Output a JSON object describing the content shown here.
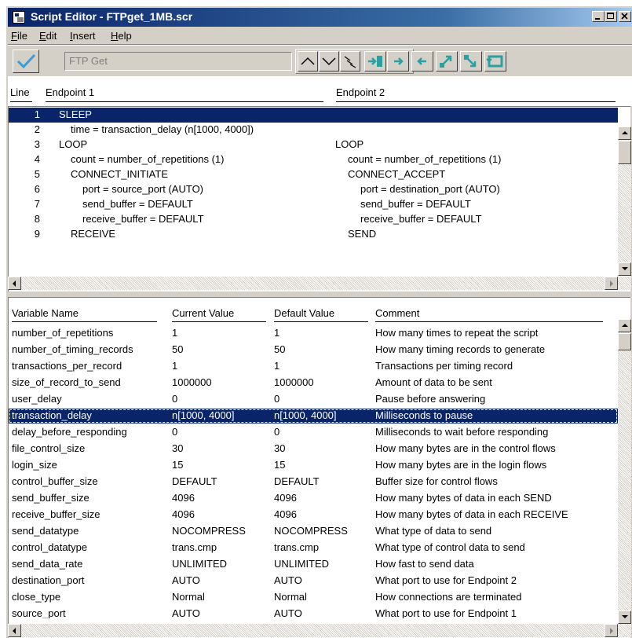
{
  "window": {
    "title": "Script Editor - FTPget_1MB.scr",
    "caption_buttons": [
      "minimize",
      "maximize",
      "close"
    ]
  },
  "menu": [
    {
      "label": "File",
      "accel": "F",
      "rest": "ile"
    },
    {
      "label": "Edit",
      "accel": "E",
      "rest": "dit"
    },
    {
      "label": "Insert",
      "accel": "I",
      "rest": "nsert"
    },
    {
      "label": "Help",
      "accel": "H",
      "rest": "elp"
    }
  ],
  "toolbar": {
    "script_name_placeholder": "FTP Get",
    "icons": [
      "checkmark-icon",
      "move-up-icon",
      "move-down-icon",
      "expand-icon",
      "insert-after-icon",
      "move-right-icon",
      "move-left-icon",
      "swap-icon",
      "copy-icon",
      "loop-icon"
    ]
  },
  "script": {
    "headers": {
      "line": "Line",
      "endpoint1": "Endpoint 1",
      "endpoint2": "Endpoint 2"
    },
    "rows": [
      {
        "num": "1",
        "ep1": "SLEEP",
        "ep2": "",
        "selected": true
      },
      {
        "num": "2",
        "ep1": "time = transaction_delay (n[1000, 4000])",
        "ep2": ""
      },
      {
        "num": "3",
        "ep1": "LOOP",
        "ep2": "LOOP"
      },
      {
        "num": "4",
        "ep1": "count = number_of_repetitions (1)",
        "ep2": "count = number_of_repetitions (1)"
      },
      {
        "num": "5",
        "ep1": "CONNECT_INITIATE",
        "ep2": "CONNECT_ACCEPT"
      },
      {
        "num": "6",
        "ep1": "port = source_port (AUTO)",
        "ep2": "port = destination_port (AUTO)"
      },
      {
        "num": "7",
        "ep1": "send_buffer = DEFAULT",
        "ep2": "send_buffer = DEFAULT"
      },
      {
        "num": "8",
        "ep1": "receive_buffer = DEFAULT",
        "ep2": "receive_buffer = DEFAULT"
      },
      {
        "num": "9",
        "ep1": "RECEIVE",
        "ep2": "SEND"
      }
    ]
  },
  "variables": {
    "headers": {
      "name": "Variable Name",
      "current": "Current Value",
      "default": "Default Value",
      "comment": "Comment"
    },
    "rows": [
      {
        "name": "number_of_repetitions",
        "current": "1",
        "default": "1",
        "comment": "How many times to repeat the script"
      },
      {
        "name": "number_of_timing_records",
        "current": "50",
        "default": "50",
        "comment": "How many timing records to generate"
      },
      {
        "name": "transactions_per_record",
        "current": "1",
        "default": "1",
        "comment": "Transactions per timing record"
      },
      {
        "name": "size_of_record_to_send",
        "current": "1000000",
        "default": "1000000",
        "comment": "Amount of data to be sent"
      },
      {
        "name": "user_delay",
        "current": "0",
        "default": "0",
        "comment": "Pause before answering"
      },
      {
        "name": "transaction_delay",
        "current": "n[1000, 4000]",
        "default": "n[1000, 4000]",
        "comment": "Milliseconds to pause",
        "selected": true
      },
      {
        "name": "delay_before_responding",
        "current": "0",
        "default": "0",
        "comment": "Milliseconds to wait before responding"
      },
      {
        "name": "file_control_size",
        "current": "30",
        "default": "30",
        "comment": "How many bytes are in the control flows"
      },
      {
        "name": "login_size",
        "current": "15",
        "default": "15",
        "comment": "How many bytes are in the login flows"
      },
      {
        "name": "control_buffer_size",
        "current": "DEFAULT",
        "default": "DEFAULT",
        "comment": "Buffer size for control flows"
      },
      {
        "name": "send_buffer_size",
        "current": "4096",
        "default": "4096",
        "comment": "How many bytes of data in each SEND"
      },
      {
        "name": "receive_buffer_size",
        "current": "4096",
        "default": "4096",
        "comment": "How many bytes of data in each RECEIVE"
      },
      {
        "name": "send_datatype",
        "current": "NOCOMPRESS",
        "default": "NOCOMPRESS",
        "comment": "What type of data to send"
      },
      {
        "name": "control_datatype",
        "current": "trans.cmp",
        "default": "trans.cmp",
        "comment": "What type of control data to send"
      },
      {
        "name": "send_data_rate",
        "current": "UNLIMITED",
        "default": "UNLIMITED",
        "comment": "How fast to send data"
      },
      {
        "name": "destination_port",
        "current": "AUTO",
        "default": "AUTO",
        "comment": "What port to use for Endpoint 2"
      },
      {
        "name": "close_type",
        "current": "Normal",
        "default": "Normal",
        "comment": "How connections are terminated"
      },
      {
        "name": "source_port",
        "current": "AUTO",
        "default": "AUTO",
        "comment": "What port to use for Endpoint 1"
      }
    ]
  },
  "colors": {
    "selection": "#0a246a",
    "face": "#d4d0c8"
  }
}
